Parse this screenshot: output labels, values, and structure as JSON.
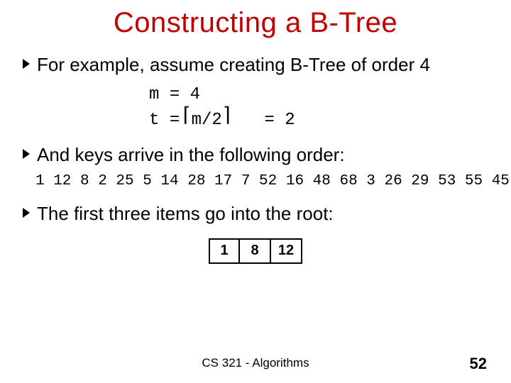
{
  "title": "Constructing a B-Tree",
  "bullet1": "For example, assume creating B-Tree of order 4",
  "formula": {
    "line1_lhs": "m",
    "line1_eq": "=",
    "line1_rhs": "4",
    "line2_lhs": "t",
    "line2_eq1": "=",
    "line2_ceil": "m/2",
    "line2_eq2": "=",
    "line2_rhs": "2"
  },
  "bullet2": "And keys arrive in the following order:",
  "key_sequence": "1 12 8 2 25 5 14 28 17 7 52 16 48 68 3 26 29 53 55 45",
  "bullet3": "The first three items go into the root:",
  "root_cells": {
    "c0": "1",
    "c1": "8",
    "c2": "12"
  },
  "footer": {
    "course": "CS 321 - Algorithms",
    "page": "52"
  }
}
